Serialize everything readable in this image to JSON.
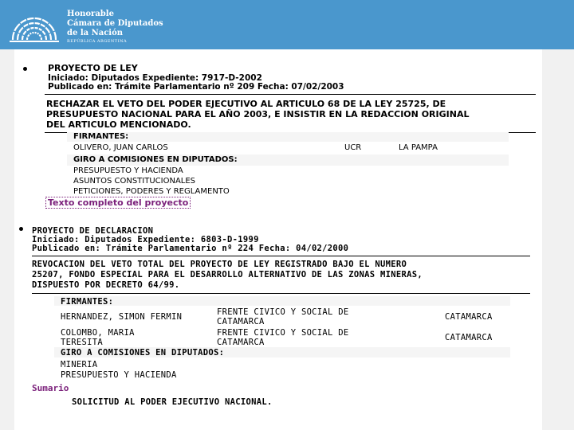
{
  "header": {
    "brand_line1": "Honorable",
    "brand_line2": "Cámara de Diputados",
    "brand_line3": "de la Nación",
    "brand_sub": "REPÚBLICA ARGENTINA"
  },
  "doc1": {
    "type": "PROYECTO DE LEY",
    "iniciado": "Iniciado: Diputados Expediente: 7917-D-2002",
    "publicado": "Publicado en: Trámite Parlamentario nº 209 Fecha: 07/02/2003",
    "summary_lines": [
      "RECHAZAR EL VETO DEL PODER EJECUTIVO AL ARTICULO 68 DE LA LEY 25725, DE",
      "PRESUPUESTO NACIONAL PARA EL AÑO 2003, E INSISTIR EN LA REDACCION ORIGINAL",
      "DEL ARTICULO MENCIONADO."
    ],
    "firmantes_label": "FIRMANTES:",
    "firmante": {
      "name": "OLIVERO, JUAN CARLOS",
      "party": "UCR",
      "province": "LA PAMPA"
    },
    "giro_label": "GIRO A COMISIONES EN DIPUTADOS:",
    "comisiones": [
      "PRESUPUESTO Y HACIENDA",
      "ASUNTOS CONSTITUCIONALES",
      "PETICIONES, PODERES Y REGLAMENTO"
    ],
    "link": "Texto completo del proyecto"
  },
  "doc2": {
    "type": "PROYECTO DE DECLARACION",
    "iniciado": "Iniciado: Diputados Expediente: 6803-D-1999",
    "publicado": "Publicado en: Trámite Parlamentario nº 224 Fecha: 04/02/2000",
    "summary_lines": [
      "REVOCACION DEL VETO TOTAL DEL PROYECTO DE LEY REGISTRADO BAJO EL NUMERO",
      "25207, FONDO ESPECIAL PARA EL DESARROLLO ALTERNATIVO DE LAS ZONAS MINERAS,",
      "DISPUESTO POR DECRETO 64/99."
    ],
    "firmantes_label": "FIRMANTES:",
    "firmantes": [
      {
        "name": "HERNANDEZ, SIMON FERMIN",
        "party_l1": "FRENTE CIVICO Y SOCIAL DE",
        "party_l2": "CATAMARCA",
        "province": "CATAMARCA"
      },
      {
        "name_l1": "COLOMBO, MARIA",
        "name_l2": "TERESITA",
        "party_l1": "FRENTE CIVICO Y SOCIAL DE",
        "party_l2": "CATAMARCA",
        "province": "CATAMARCA"
      }
    ],
    "giro_label": "GIRO A COMISIONES EN DIPUTADOS:",
    "comisiones": [
      "MINERIA",
      "PRESUPUESTO Y HACIENDA"
    ],
    "sumario": "Sumario",
    "sumario_text": "SOLICITUD AL PODER EJECUTIVO NACIONAL."
  }
}
